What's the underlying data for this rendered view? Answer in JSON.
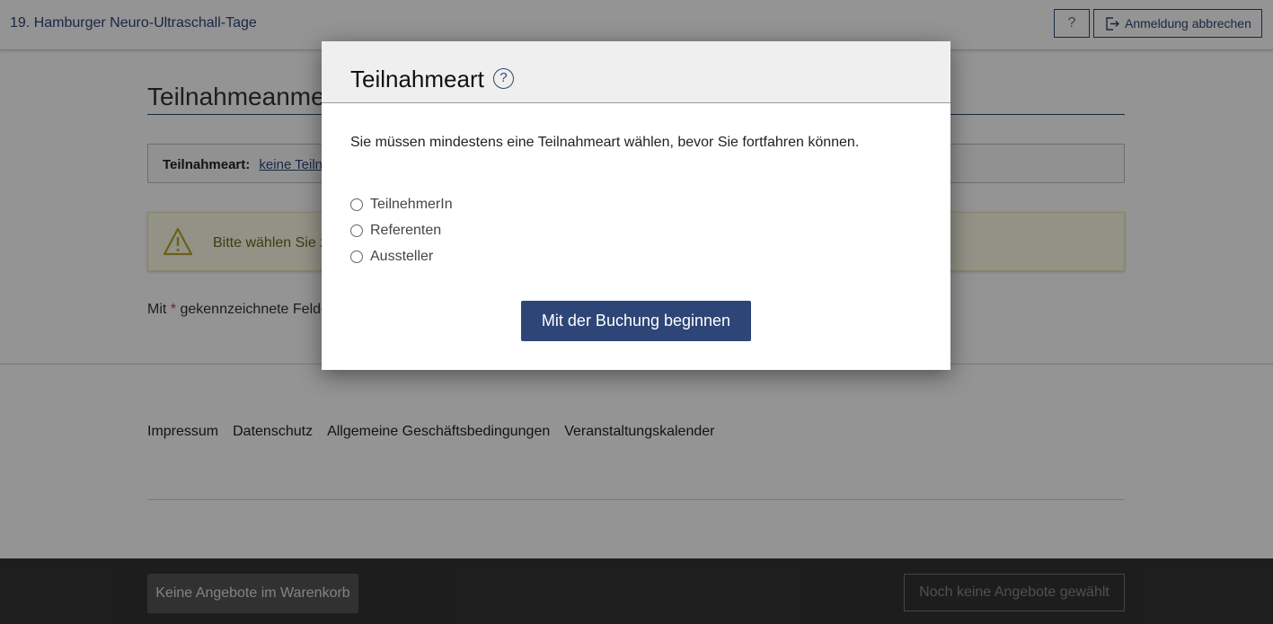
{
  "header": {
    "title": "19. Hamburger Neuro-Ultraschall-Tage",
    "help_label": "?",
    "cancel_label": "Anmeldung abbrechen"
  },
  "page": {
    "title_visible": "Teilnahmeanme",
    "type_label": "Teilnahmeart:",
    "type_link_visible": "keine Teiln",
    "warning_visible": "Bitte wählen Sie z",
    "required_prefix": "Mit",
    "required_star": "*",
    "required_suffix_visible": "gekennzeichnete Felde"
  },
  "footer": {
    "links": [
      "Impressum",
      "Datenschutz",
      "Allgemeine Geschäftsbedingungen",
      "Veranstaltungskalender"
    ]
  },
  "bottom_bar": {
    "cart_label": "Keine Angebote im Warenkorb",
    "no_offers_label": "Noch keine Angebote gewählt"
  },
  "modal": {
    "title": "Teilnahmeart",
    "help_label": "?",
    "message": "Sie müssen mindestens eine Teilnahmeart wählen, bevor Sie fortfahren können.",
    "options": [
      {
        "label": "TeilnehmerIn",
        "selected": false
      },
      {
        "label": "Referenten",
        "selected": false
      },
      {
        "label": "Aussteller",
        "selected": false
      }
    ],
    "start_label": "Mit der Buchung beginnen"
  },
  "colors": {
    "brand": "#2e4577",
    "warning_bg": "#fbfbe8",
    "warning_icon": "#b5a82a",
    "bottom_bar": "#333333"
  }
}
